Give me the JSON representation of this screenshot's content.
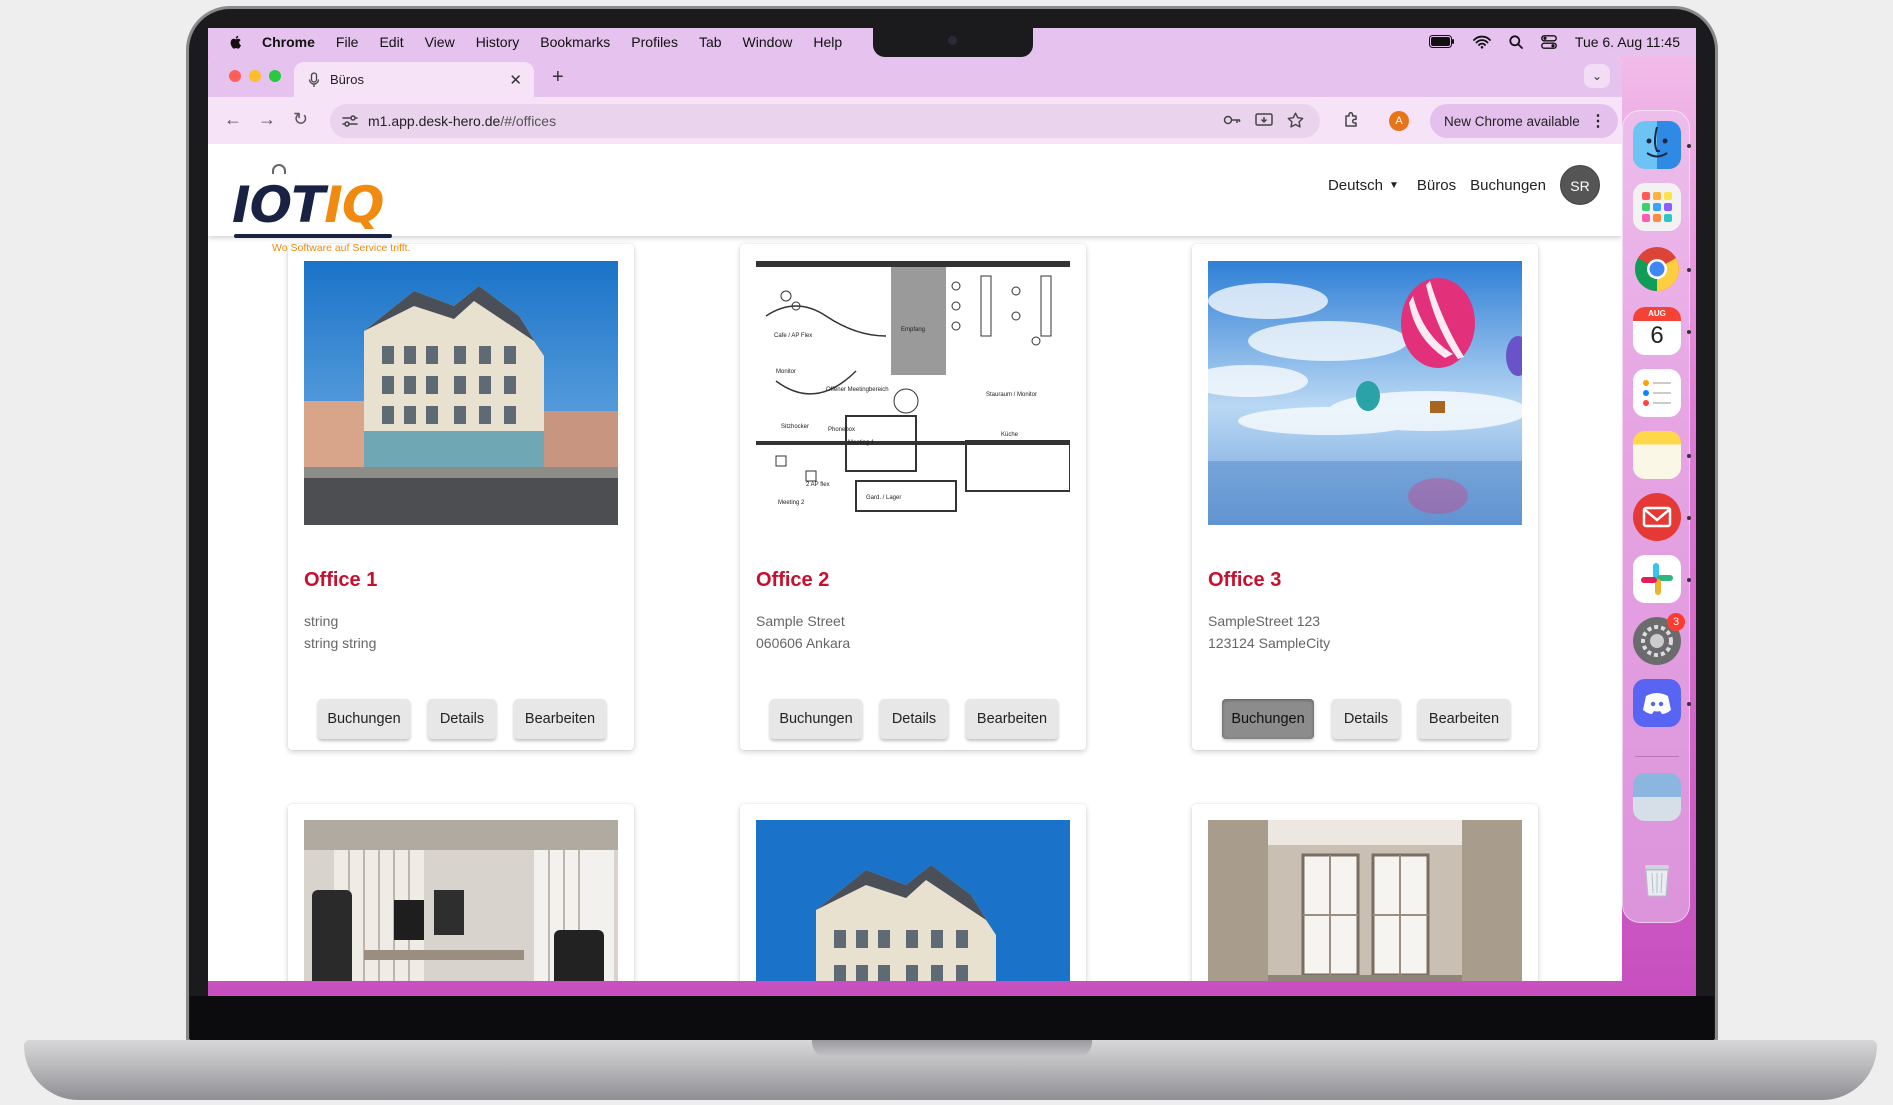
{
  "menubar": {
    "items": [
      "Chrome",
      "File",
      "Edit",
      "View",
      "History",
      "Bookmarks",
      "Profiles",
      "Tab",
      "Window",
      "Help"
    ],
    "datetime": "Tue 6. Aug 11:45"
  },
  "browser": {
    "tab_title": "Büros",
    "url_host": "m1.app.desk-hero.de",
    "url_path": "/#/offices",
    "profile_initial": "A",
    "update_label": "New Chrome available"
  },
  "app": {
    "logo_io": "IOT",
    "logo_iq": "IQ",
    "logo_tagline": "Wo Software auf Service trifft.",
    "nav": {
      "language": "Deutsch",
      "offices": "Büros",
      "bookings": "Buchungen",
      "avatar": "SR"
    }
  },
  "offices": [
    {
      "name": "Office 1",
      "address_line1": "string",
      "address_line2": "string string",
      "image": "building-photo"
    },
    {
      "name": "Office 2",
      "address_line1": "Sample Street",
      "address_line2": "060606 Ankara",
      "image": "floor-plan"
    },
    {
      "name": "Office 3",
      "address_line1": "SampleStreet 123",
      "address_line2": "123124 SampleCity",
      "image": "hot-air-balloons"
    }
  ],
  "card_actions": {
    "bookings": "Buchungen",
    "details": "Details",
    "edit": "Bearbeiten"
  },
  "active_action": {
    "office_index": 2,
    "action": "Buchungen"
  },
  "floorplan_labels": {
    "cafe": "Cafe / AP Flex",
    "monitor": "Monitor",
    "reception": "Empfang",
    "meeting_open": "Offener Meetingbereich",
    "storage_monitor": "Stauraum / Monitor",
    "stools": "Sitzhocker",
    "phonebox": "Phonebox",
    "meeting1": "Meeting 1",
    "kitchen": "Küche",
    "ap_flex2": "2 AP flex",
    "meeting2": "Meeting 2",
    "wardrobe": "Gard. / Lager"
  },
  "dock": {
    "apps": [
      "finder-icon",
      "launchpad-icon",
      "chrome-icon",
      "calendar-icon",
      "reminders-icon",
      "notes-icon",
      "mail-icon",
      "slack-icon",
      "system-settings-icon",
      "discord-icon",
      "preview-icon",
      "trash-icon"
    ],
    "calendar_month": "AUG",
    "calendar_day": "6",
    "settings_badge": "3"
  },
  "colors": {
    "accent_red": "#c8102e",
    "logo_navy": "#1a2244",
    "logo_orange": "#f08a10",
    "chrome_theme": "#e6c3ee"
  }
}
